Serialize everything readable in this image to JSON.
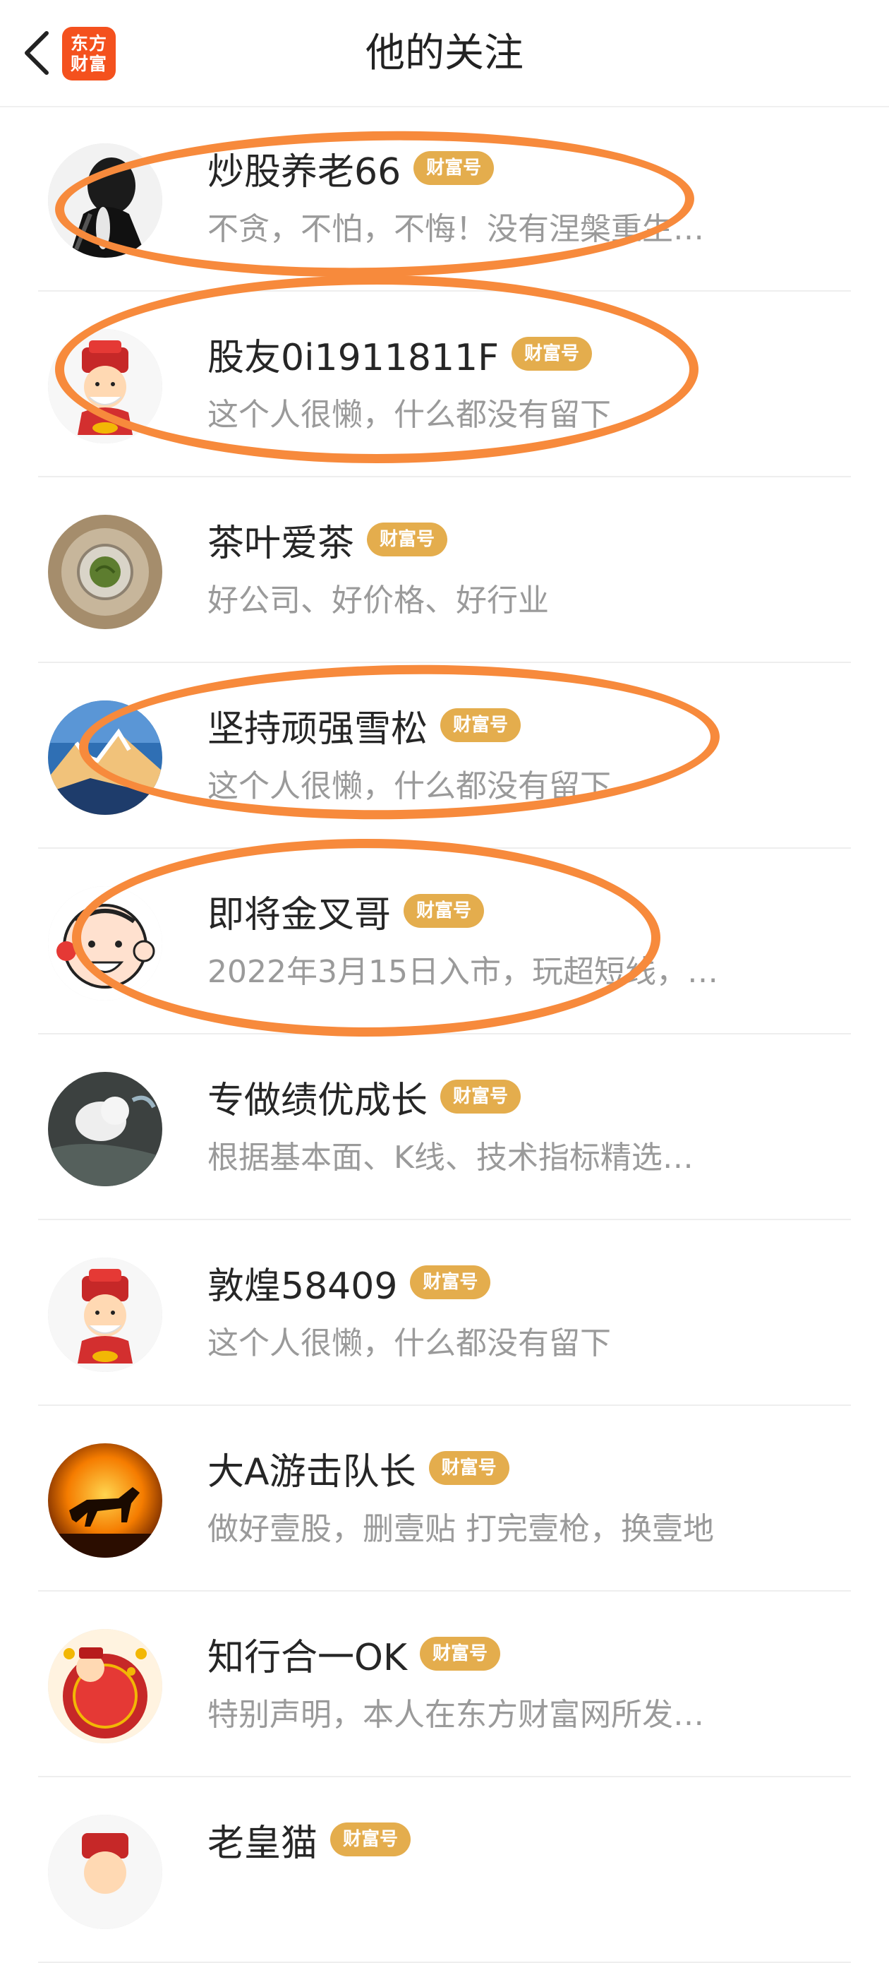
{
  "header": {
    "title": "他的关注",
    "logo_line1": "东方",
    "logo_line2": "财富",
    "back_icon": "chevron-left-icon"
  },
  "badge_label": "财富号",
  "colors": {
    "badge": "#e4ad4d",
    "annotation": "#f78a3c",
    "logo": "#f4511e"
  },
  "users": [
    {
      "name": "炒股养老66",
      "desc": "不贪，不怕，不悔！没有涅槃重生…",
      "avatar": "dark-figure"
    },
    {
      "name": "股友0i1911811F",
      "desc": "这个人很懒，什么都没有留下",
      "avatar": "caishen-cartoon"
    },
    {
      "name": "茶叶爱茶",
      "desc": "好公司、好价格、好行业",
      "avatar": "tea-cup"
    },
    {
      "name": "坚持顽强雪松",
      "desc": "这个人很懒，什么都没有留下",
      "avatar": "snow-mountain"
    },
    {
      "name": "即将金叉哥",
      "desc": "2022年3月15日入市，玩超短线，…",
      "avatar": "cartoon-face"
    },
    {
      "name": "专做绩优成长",
      "desc": "根据基本面、K线、技术指标精选…",
      "avatar": "white-cat"
    },
    {
      "name": "敦煌58409",
      "desc": "这个人很懒，什么都没有留下",
      "avatar": "caishen-cartoon"
    },
    {
      "name": "大A游击队长",
      "desc": "做好壹股，删壹贴 打完壹枪，换壹地",
      "avatar": "horse-sunset"
    },
    {
      "name": "知行合一OK",
      "desc": "特别声明，本人在东方财富网所发…",
      "avatar": "caishen-red"
    },
    {
      "name": "老皇猫",
      "desc": "",
      "avatar": "caishen-cartoon"
    }
  ]
}
